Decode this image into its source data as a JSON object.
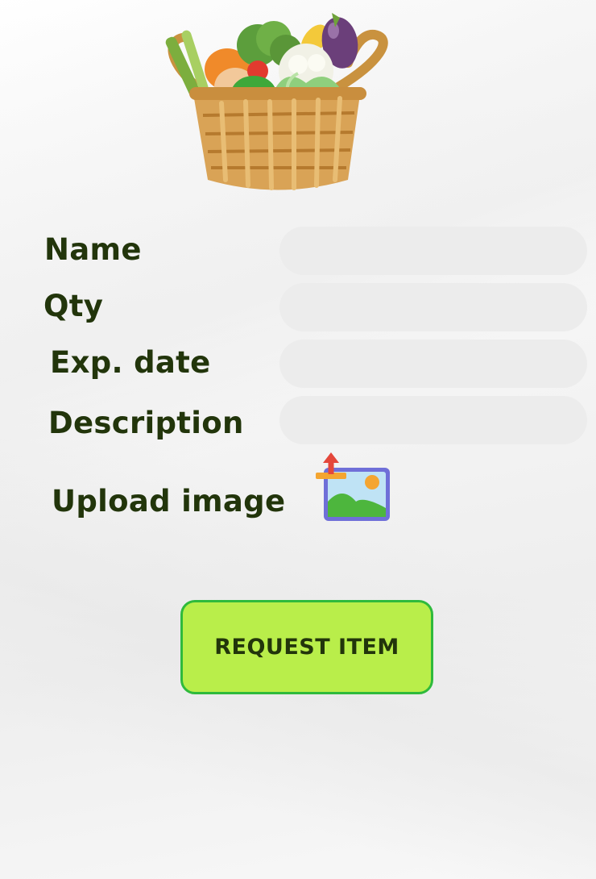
{
  "form": {
    "fields": [
      {
        "label": "Name",
        "value": "",
        "placeholder": ""
      },
      {
        "label": "Qty",
        "value": "",
        "placeholder": ""
      },
      {
        "label": "Exp. date",
        "value": "",
        "placeholder": ""
      },
      {
        "label": "Description",
        "value": "",
        "placeholder": ""
      }
    ],
    "upload_label": "Upload image",
    "upload_icon": "image-upload-icon",
    "submit_label": "REQUEST ITEM"
  },
  "header_image": "vegetable-basket-illustration",
  "colors": {
    "label_text": "#22350b",
    "field_background": "#ececec",
    "button_fill": "#b9ee4a",
    "button_border": "#2fba3c"
  }
}
